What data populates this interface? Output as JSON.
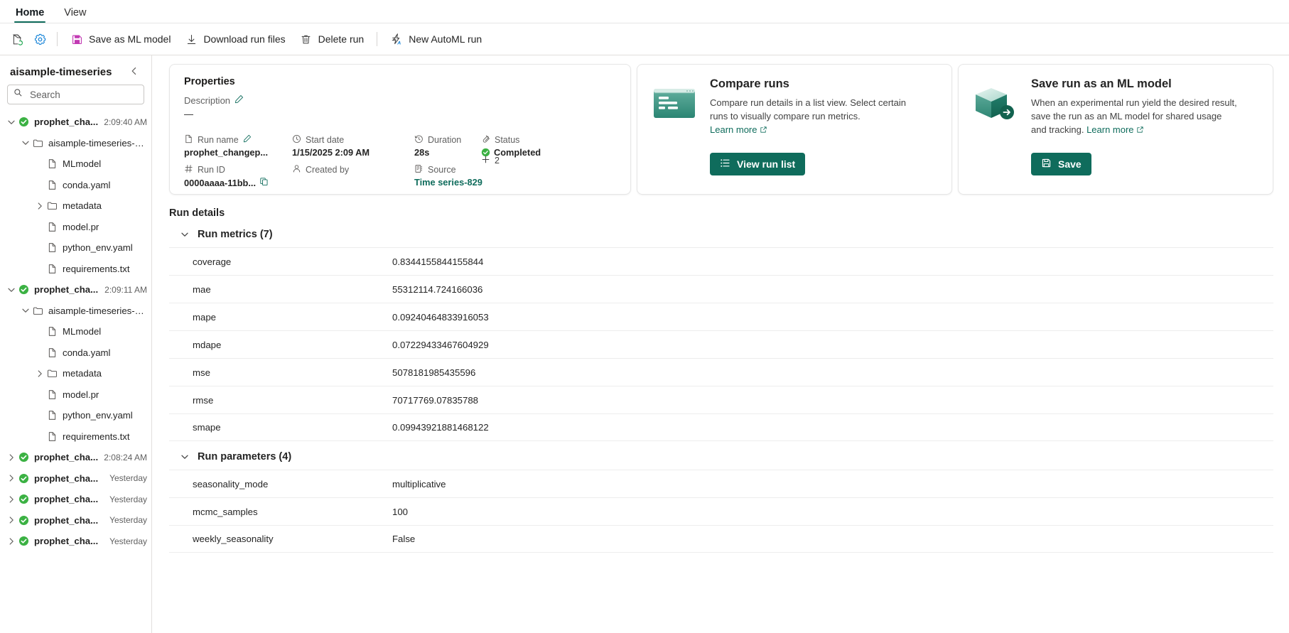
{
  "ribbon": {
    "tabs": [
      {
        "label": "Home",
        "active": true
      },
      {
        "label": "View",
        "active": false
      }
    ]
  },
  "toolbar": {
    "refresh_icon": "refresh-page-icon",
    "settings_icon": "gear-icon",
    "buttons": [
      {
        "label": "Save as ML model",
        "icon": "save-icon"
      },
      {
        "label": "Download run files",
        "icon": "download-icon"
      },
      {
        "label": "Delete run",
        "icon": "trash-icon"
      },
      {
        "label": "New AutoML run",
        "icon": "automl-lightning-icon"
      }
    ]
  },
  "sidebar": {
    "title": "aisample-timeseries",
    "collapse_icon": "chevron-left-icon",
    "search": {
      "placeholder": "Search",
      "value": "",
      "icon": "search-icon"
    },
    "tree": [
      {
        "label": "prophet_cha...",
        "time": "2:09:40 AM",
        "depth": 0,
        "kind": "run",
        "expanded": true
      },
      {
        "label": "aisample-timeseries-pr...",
        "time": "",
        "depth": 1,
        "kind": "folder",
        "expanded": true
      },
      {
        "label": "MLmodel",
        "time": "",
        "depth": 2,
        "kind": "file"
      },
      {
        "label": "conda.yaml",
        "time": "",
        "depth": 2,
        "kind": "file"
      },
      {
        "label": "metadata",
        "time": "",
        "depth": 2,
        "kind": "folder",
        "expanded": false
      },
      {
        "label": "model.pr",
        "time": "",
        "depth": 2,
        "kind": "file"
      },
      {
        "label": "python_env.yaml",
        "time": "",
        "depth": 2,
        "kind": "file"
      },
      {
        "label": "requirements.txt",
        "time": "",
        "depth": 2,
        "kind": "file"
      },
      {
        "label": "prophet_cha...",
        "time": "2:09:11 AM",
        "depth": 0,
        "kind": "run",
        "expanded": true
      },
      {
        "label": "aisample-timeseries-pr...",
        "time": "",
        "depth": 1,
        "kind": "folder",
        "expanded": true
      },
      {
        "label": "MLmodel",
        "time": "",
        "depth": 2,
        "kind": "file"
      },
      {
        "label": "conda.yaml",
        "time": "",
        "depth": 2,
        "kind": "file"
      },
      {
        "label": "metadata",
        "time": "",
        "depth": 2,
        "kind": "folder",
        "expanded": false
      },
      {
        "label": "model.pr",
        "time": "",
        "depth": 2,
        "kind": "file"
      },
      {
        "label": "python_env.yaml",
        "time": "",
        "depth": 2,
        "kind": "file"
      },
      {
        "label": "requirements.txt",
        "time": "",
        "depth": 2,
        "kind": "file"
      },
      {
        "label": "prophet_cha...",
        "time": "2:08:24 AM",
        "depth": 0,
        "kind": "run",
        "expanded": false
      },
      {
        "label": "prophet_cha...",
        "time": "Yesterday",
        "depth": 0,
        "kind": "run",
        "expanded": false
      },
      {
        "label": "prophet_cha...",
        "time": "Yesterday",
        "depth": 0,
        "kind": "run",
        "expanded": false
      },
      {
        "label": "prophet_cha...",
        "time": "Yesterday",
        "depth": 0,
        "kind": "run",
        "expanded": false
      },
      {
        "label": "prophet_cha...",
        "time": "Yesterday",
        "depth": 0,
        "kind": "run",
        "expanded": false
      }
    ]
  },
  "properties": {
    "title": "Properties",
    "description_label": "Description",
    "description_value": "—",
    "edit_icon": "pencil-icon",
    "fields": [
      {
        "key": "Run name",
        "value": "prophet_changep...",
        "icon": "file-icon",
        "editable": true
      },
      {
        "key": "Start date",
        "value": "1/15/2025 2:09 AM",
        "icon": "clock-icon"
      },
      {
        "key": "Duration",
        "value": "28s",
        "icon": "timer-icon"
      },
      {
        "key": "Status",
        "value": "Completed",
        "icon": "status-icon",
        "status": true
      },
      {
        "key": "Run ID",
        "value": "0000aaaa-11bb...",
        "icon": "hash-icon",
        "copy": true
      },
      {
        "key": "Created by",
        "value": "",
        "icon": "person-icon"
      },
      {
        "key": "Source",
        "value": "Time series-829",
        "icon": "source-icon",
        "link": true
      }
    ],
    "more_count": "2",
    "more_icon": "plus-icon"
  },
  "compare_card": {
    "icon": "compare-runs-illustration",
    "title": "Compare runs",
    "description": "Compare run details in a list view. Select certain runs to visually compare run metrics.",
    "learn_more": "Learn more",
    "external_icon": "external-link-icon",
    "button_label": "View run list",
    "button_icon": "list-icon"
  },
  "save_card": {
    "icon": "ml-model-cube-illustration",
    "title": "Save run as an ML model",
    "description": "When an experimental run yield the desired result, save the run as an ML model for shared usage and tracking.",
    "learn_more": "Learn more",
    "external_icon": "external-link-icon",
    "button_label": "Save",
    "button_icon": "save-icon"
  },
  "run_details": {
    "title": "Run details",
    "metrics_section": {
      "label": "Run metrics (7)",
      "chevron": "chevron-down-icon",
      "rows": [
        {
          "key": "coverage",
          "value": "0.8344155844155844"
        },
        {
          "key": "mae",
          "value": "55312114.724166036"
        },
        {
          "key": "mape",
          "value": "0.09240464833916053"
        },
        {
          "key": "mdape",
          "value": "0.07229433467604929"
        },
        {
          "key": "mse",
          "value": "5078181985435596"
        },
        {
          "key": "rmse",
          "value": "70717769.07835788"
        },
        {
          "key": "smape",
          "value": "0.09943921881468122"
        }
      ]
    },
    "parameters_section": {
      "label": "Run parameters (4)",
      "chevron": "chevron-down-icon",
      "rows": [
        {
          "key": "seasonality_mode",
          "value": "multiplicative"
        },
        {
          "key": "mcmc_samples",
          "value": "100"
        },
        {
          "key": "weekly_seasonality",
          "value": "False"
        }
      ]
    }
  },
  "colors": {
    "accent": "#0f6c5c",
    "success": "#3bb143",
    "magenta": "#c239b3",
    "blue": "#0078d4",
    "text": "#242424",
    "muted": "#616161"
  }
}
